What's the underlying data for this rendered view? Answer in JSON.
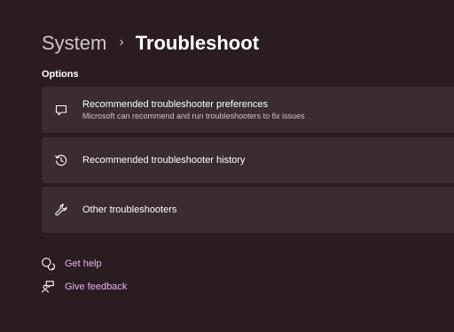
{
  "breadcrumb": {
    "parent": "System",
    "separator": "›",
    "current": "Troubleshoot"
  },
  "options_label": "Options",
  "cards": [
    {
      "icon": "chat-bubble-icon",
      "title": "Recommended troubleshooter preferences",
      "subtitle": "Microsoft can recommend and run troubleshooters to fix issues"
    },
    {
      "icon": "history-icon",
      "title": "Recommended troubleshooter history"
    },
    {
      "icon": "wrench-icon",
      "title": "Other troubleshooters"
    }
  ],
  "links": {
    "help": {
      "icon": "get-help-icon",
      "label": "Get help"
    },
    "feedback": {
      "icon": "feedback-icon",
      "label": "Give feedback"
    }
  },
  "colors": {
    "background": "#2a1c20",
    "card": "#3a2c30",
    "link_accent": "#e6b4ee",
    "text": "#ffffff",
    "muted_text": "#cfc3c6"
  }
}
